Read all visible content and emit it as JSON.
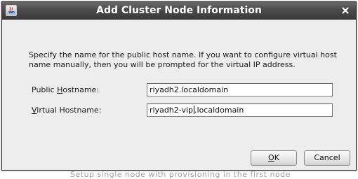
{
  "dialog": {
    "title": "Add Cluster Node Information",
    "instruction": "Specify the name for the public host name. If you want to configure virtual host name manually, then you will be prompted for the virtual IP address."
  },
  "fields": {
    "public_hostname": {
      "label_prefix": "Public ",
      "label_mnemonic": "H",
      "label_suffix": "ostname:",
      "value": "riyadh2.localdomain"
    },
    "virtual_hostname": {
      "label_prefix": "",
      "label_mnemonic": "V",
      "label_suffix": "irtual Hostname:",
      "value_before_caret": "riyadh2-vip",
      "value_after_caret": ".localdomain"
    }
  },
  "buttons": {
    "ok": {
      "mnemonic": "O",
      "rest": "K"
    },
    "cancel": {
      "label": "Cancel"
    }
  },
  "background": {
    "partial_text": "Setup single node with provisioning in the first node"
  },
  "icons": {
    "title_icon": "java-window-icon",
    "close": "close-icon"
  },
  "colors": {
    "titlebar": "#4b4b4b",
    "dialog_bg": "#ededed",
    "title_text": "#ffffff"
  }
}
